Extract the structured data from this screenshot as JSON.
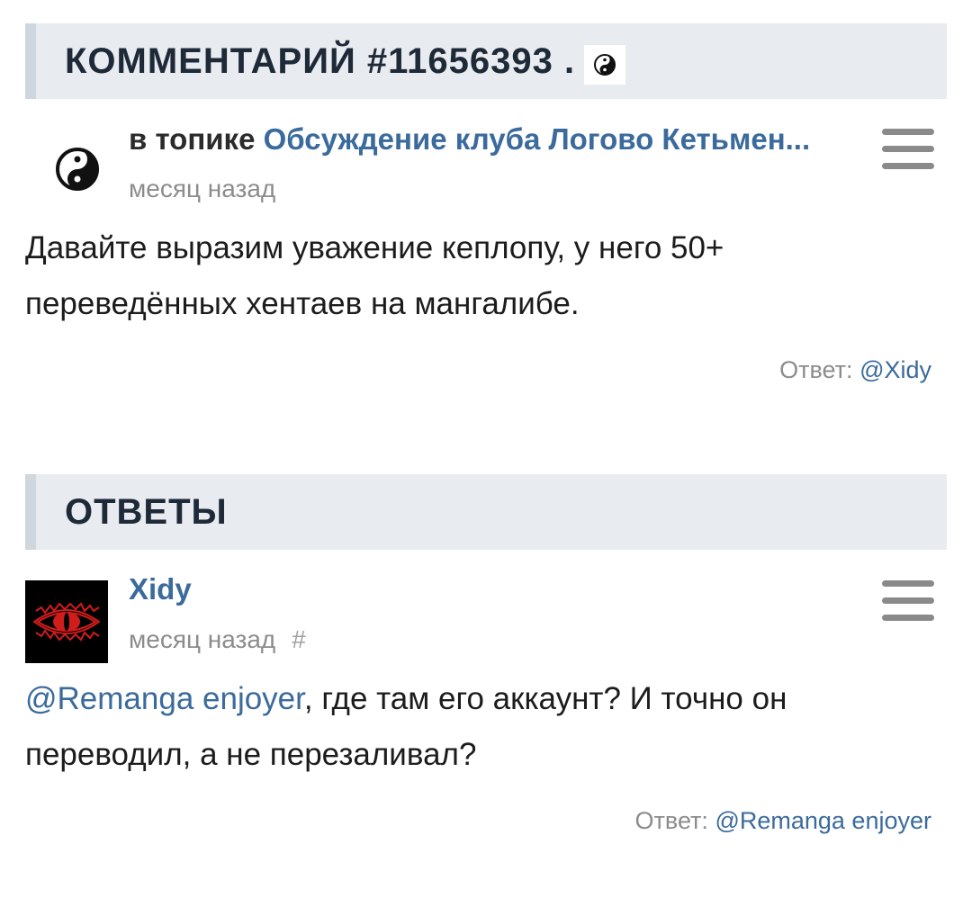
{
  "comment_section": {
    "title": "КОММЕНТАРИЙ #11656393 .",
    "header_icon": "yin-yang-icon"
  },
  "comment": {
    "avatar_icon": "yin-yang-icon",
    "topic_prefix": "в топике",
    "topic_title": "Обсуждение клуба Логово Кетьмен...",
    "time": "месяц назад",
    "text": "Давайте выразим уважение кеплопу, у него 50+ переведённых хентаев на мангалибе.",
    "reply_label": "Ответ:",
    "reply_link": "@Xidy"
  },
  "answers_section": {
    "title": "ОТВЕТЫ"
  },
  "answer": {
    "avatar_icon": "red-eye-icon",
    "username": "Xidy",
    "time": "месяц назад",
    "hash": "#",
    "mention": "@Remanga enjoyer",
    "text": ", где там его аккаунт? И точно он переводил, а не перезаливал?",
    "reply_label": "Ответ:",
    "reply_link": "@Remanga enjoyer"
  },
  "colors": {
    "link": "#3b6b9c",
    "muted": "#8c8c8c",
    "header_bg": "#e8ebef"
  }
}
